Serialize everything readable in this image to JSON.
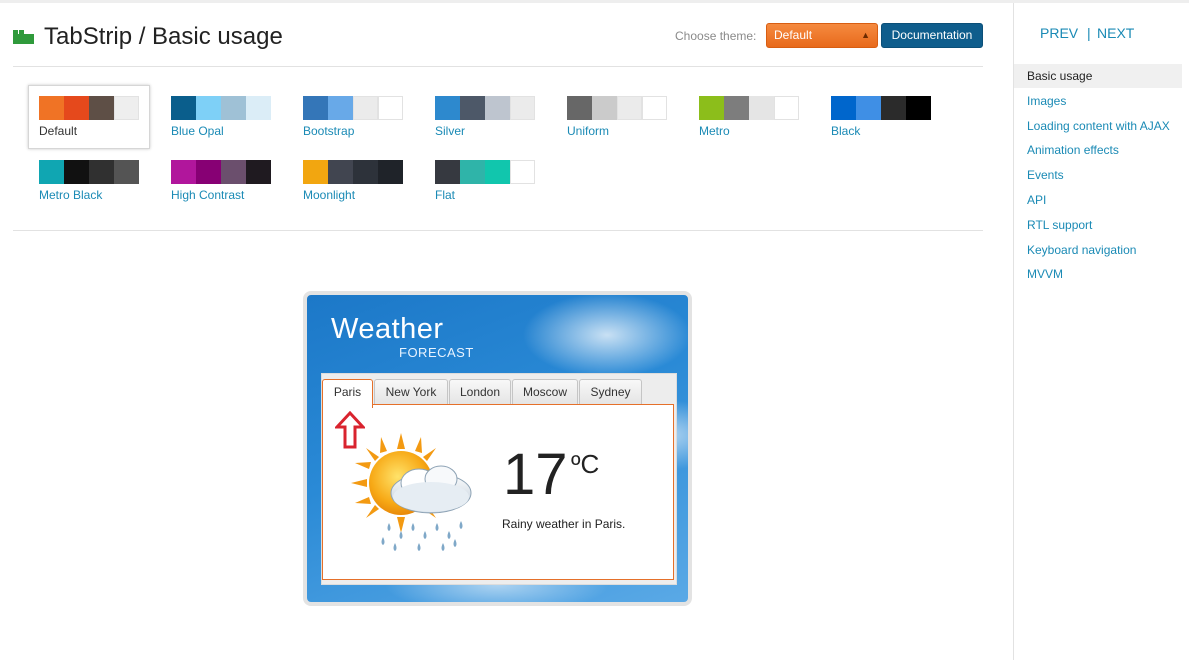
{
  "header": {
    "title": "TabStrip / Basic usage",
    "theme_label": "Choose theme:",
    "theme_value": "Default",
    "doc_label": "Documentation"
  },
  "themes": [
    {
      "name": "Default",
      "colors": [
        "#f07325",
        "#e5491c",
        "#5e4f46",
        "#eeeeee"
      ],
      "selected": true
    },
    {
      "name": "Blue Opal",
      "colors": [
        "#0a5e8c",
        "#7ed0f7",
        "#9fc1d6",
        "#dbedf7"
      ]
    },
    {
      "name": "Bootstrap",
      "colors": [
        "#3476b8",
        "#68a9e8",
        "#ebebeb",
        "#ffffff"
      ]
    },
    {
      "name": "Silver",
      "colors": [
        "#2d89ce",
        "#4d5868",
        "#bec5cf",
        "#ebebeb"
      ]
    },
    {
      "name": "Uniform",
      "colors": [
        "#676767",
        "#cbcbcb",
        "#ebebeb",
        "#ffffff"
      ]
    },
    {
      "name": "Metro",
      "colors": [
        "#8cbe1b",
        "#7d7d7d",
        "#e5e5e5",
        "#ffffff"
      ]
    },
    {
      "name": "Black",
      "colors": [
        "#0066cc",
        "#3f8fe5",
        "#2b2b2b",
        "#000000"
      ]
    },
    {
      "name": "Metro Black",
      "colors": [
        "#10a6b2",
        "#111111",
        "#303030",
        "#545454"
      ]
    },
    {
      "name": "High Contrast",
      "colors": [
        "#b1169c",
        "#870074",
        "#6b4f6d",
        "#1f1a20"
      ]
    },
    {
      "name": "Moonlight",
      "colors": [
        "#f2a610",
        "#414550",
        "#2d323a",
        "#1f2329"
      ]
    },
    {
      "name": "Flat",
      "colors": [
        "#363940",
        "#2fb4a9",
        "#11c6ad",
        "#ffffff"
      ]
    }
  ],
  "widget": {
    "title": "Weather",
    "subtitle": "FORECAST",
    "tabs": [
      "Paris",
      "New York",
      "London",
      "Moscow",
      "Sydney"
    ],
    "active_tab": "Paris",
    "temperature": "17",
    "unit": "ºC",
    "description": "Rainy weather in Paris.",
    "accent": "#e5702a"
  },
  "sidebar": {
    "prev": "PREV",
    "separator": "|",
    "next": "NEXT",
    "items": [
      "Basic usage",
      "Images",
      "Loading content with AJAX",
      "Animation effects",
      "Events",
      "API",
      "RTL support",
      "Keyboard navigation",
      "MVVM"
    ],
    "active": "Basic usage"
  }
}
